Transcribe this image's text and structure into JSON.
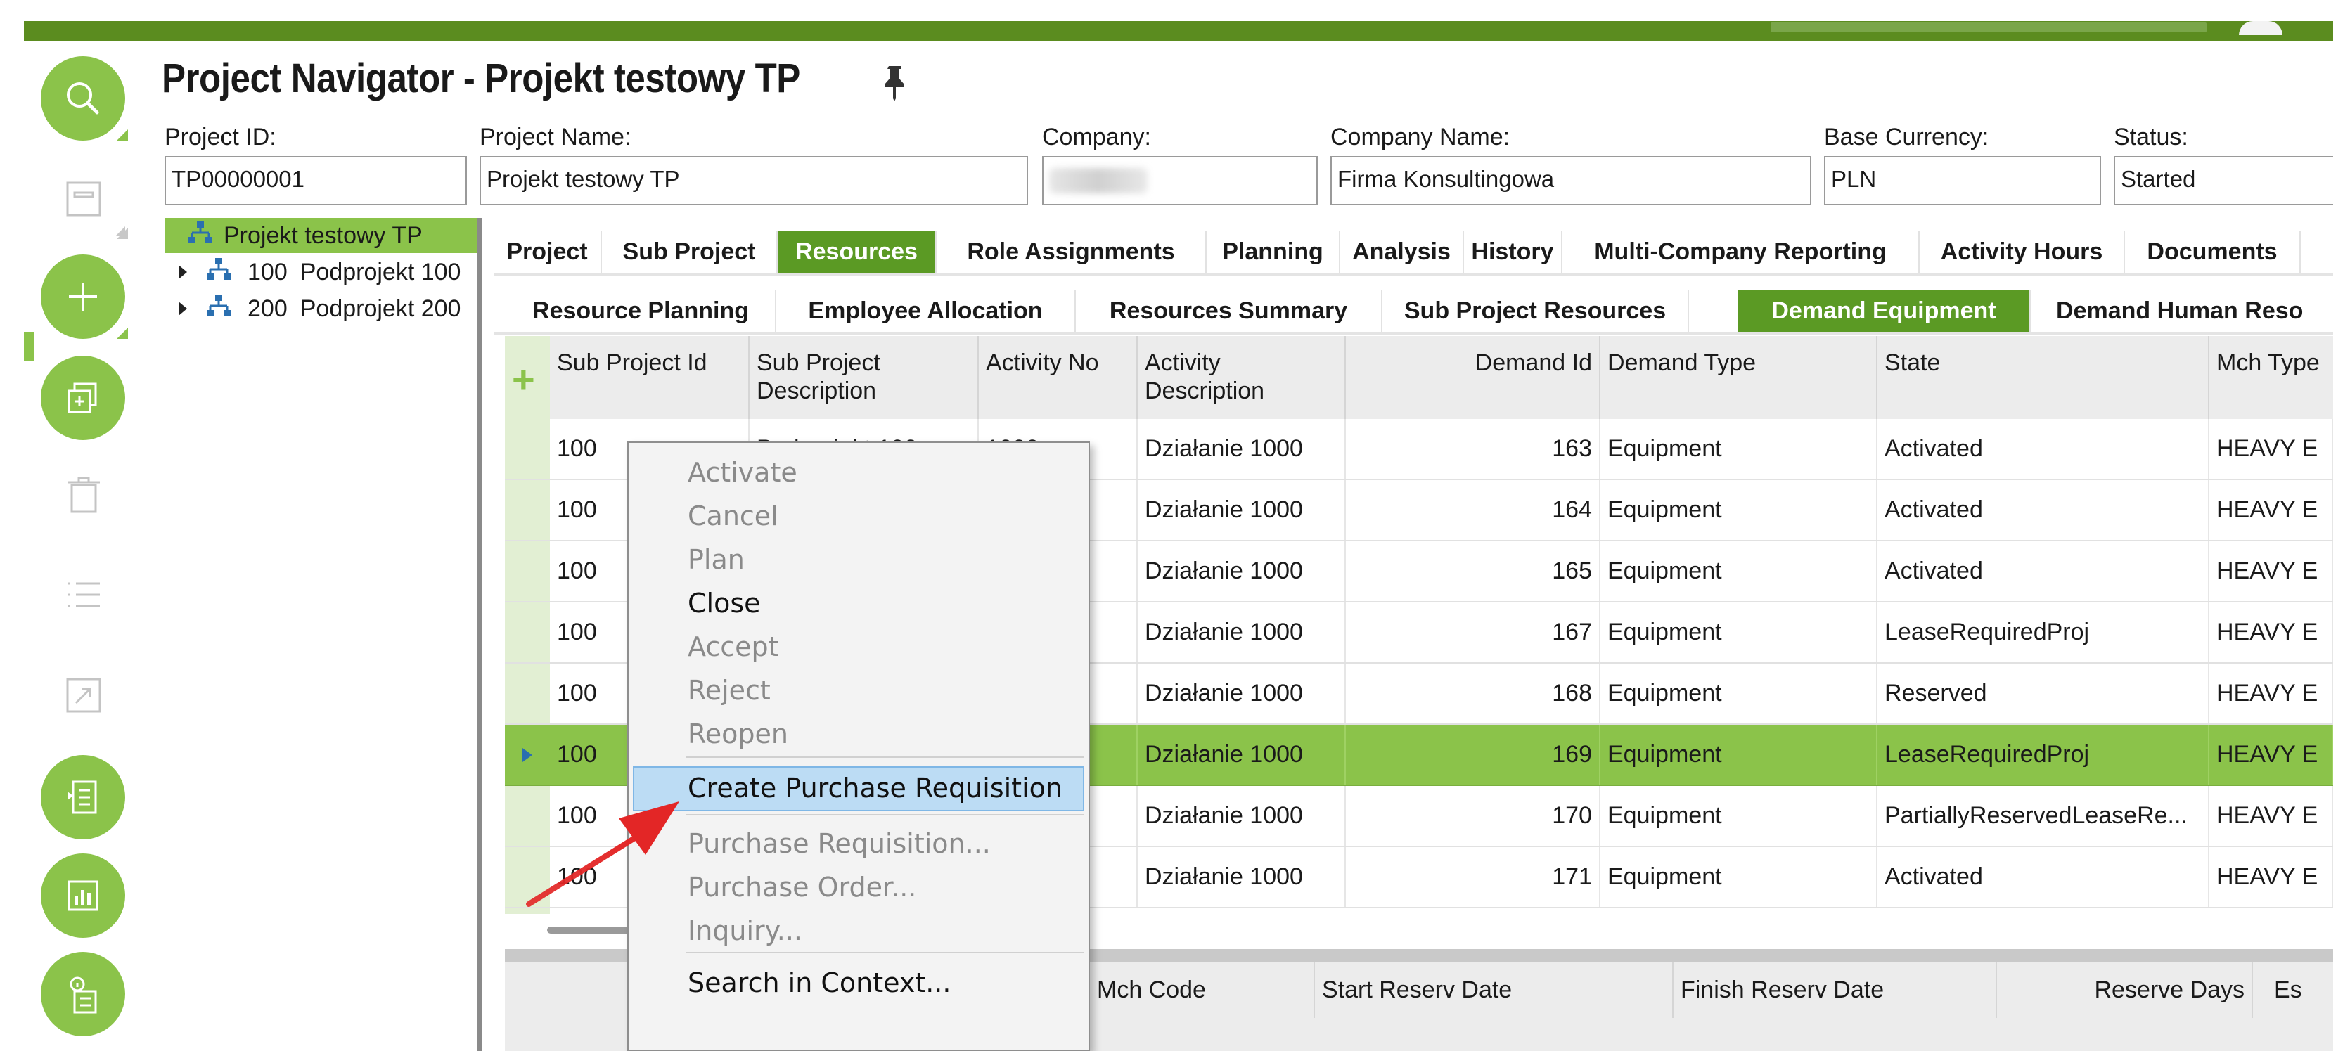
{
  "window": {
    "title": "Project Navigator - Projekt testowy TP"
  },
  "colors": {
    "accent": "#8bc34a",
    "accent_dark": "#5b9a24",
    "selection_blue": "#bcdcf4",
    "callout": "#e32626"
  },
  "rail": {
    "icons": [
      "search-icon",
      "save-icon",
      "add-icon",
      "duplicate-icon",
      "delete-icon",
      "list-icon",
      "expand-icon",
      "report-icon",
      "chart-icon",
      "info-icon"
    ]
  },
  "header": {
    "fields": [
      {
        "label": "Project ID:",
        "value": "TP00000001"
      },
      {
        "label": "Project Name:",
        "value": "Projekt testowy TP"
      },
      {
        "label": "Company:",
        "value": ""
      },
      {
        "label": "Company Name:",
        "value": "Firma Konsultingowa"
      },
      {
        "label": "Base Currency:",
        "value": "PLN"
      },
      {
        "label": "Status:",
        "value": "Started"
      }
    ]
  },
  "tree": {
    "root": "Projekt testowy TP",
    "children": [
      {
        "id": "100",
        "name": "Podprojekt 100"
      },
      {
        "id": "200",
        "name": "Podprojekt 200"
      }
    ]
  },
  "tabs": {
    "main": [
      "Project",
      "Sub Project",
      "Resources",
      "Role Assignments",
      "Planning",
      "Analysis",
      "History",
      "Multi-Company Reporting",
      "Activity Hours",
      "Documents"
    ],
    "main_active": "Resources",
    "sub": [
      "Resource Planning",
      "Employee Allocation",
      "Resources Summary",
      "Sub Project Resources",
      "Demand Equipment",
      "Demand Human Reso"
    ],
    "sub_active": "Demand Equipment"
  },
  "grid": {
    "columns": [
      "Sub Project Id",
      "Sub Project Description",
      "Activity No",
      "Activity Description",
      "Demand Id",
      "Demand Type",
      "State",
      "Mch Type"
    ],
    "rows": [
      {
        "sub_project_id": "100",
        "sub_project_desc": "Podprojekt 100",
        "activity_no": "1000",
        "activity_desc": "Działanie 1000",
        "demand_id": "163",
        "demand_type": "Equipment",
        "state": "Activated",
        "mch_type": "HEAVY E"
      },
      {
        "sub_project_id": "100",
        "sub_project_desc": "",
        "activity_no": "",
        "activity_desc": "Działanie 1000",
        "demand_id": "164",
        "demand_type": "Equipment",
        "state": "Activated",
        "mch_type": "HEAVY E"
      },
      {
        "sub_project_id": "100",
        "sub_project_desc": "",
        "activity_no": "",
        "activity_desc": "Działanie 1000",
        "demand_id": "165",
        "demand_type": "Equipment",
        "state": "Activated",
        "mch_type": "HEAVY E"
      },
      {
        "sub_project_id": "100",
        "sub_project_desc": "",
        "activity_no": "",
        "activity_desc": "Działanie 1000",
        "demand_id": "167",
        "demand_type": "Equipment",
        "state": "LeaseRequiredProj",
        "mch_type": "HEAVY E"
      },
      {
        "sub_project_id": "100",
        "sub_project_desc": "",
        "activity_no": "",
        "activity_desc": "Działanie 1000",
        "demand_id": "168",
        "demand_type": "Equipment",
        "state": "Reserved",
        "mch_type": "HEAVY E"
      },
      {
        "sub_project_id": "100",
        "sub_project_desc": "",
        "activity_no": "",
        "activity_desc": "Działanie 1000",
        "demand_id": "169",
        "demand_type": "Equipment",
        "state": "LeaseRequiredProj",
        "mch_type": "HEAVY E"
      },
      {
        "sub_project_id": "100",
        "sub_project_desc": "",
        "activity_no": "",
        "activity_desc": "Działanie 1000",
        "demand_id": "170",
        "demand_type": "Equipment",
        "state": "PartiallyReservedLeaseRe...",
        "mch_type": "HEAVY E"
      },
      {
        "sub_project_id": "100",
        "sub_project_desc": "",
        "activity_no": "",
        "activity_desc": "Działanie 1000",
        "demand_id": "171",
        "demand_type": "Equipment",
        "state": "Activated",
        "mch_type": "HEAVY E"
      }
    ],
    "selected_row_index": 5
  },
  "detail_grid": {
    "columns": [
      "Mch Code",
      "Start Reserv Date",
      "Finish Reserv Date",
      "Reserve Days",
      "Es"
    ]
  },
  "context_menu": {
    "items": [
      {
        "label": "Activate",
        "enabled": false
      },
      {
        "label": "Cancel",
        "enabled": false
      },
      {
        "label": "Plan",
        "enabled": false
      },
      {
        "label": "Close",
        "enabled": true
      },
      {
        "label": "Accept",
        "enabled": false
      },
      {
        "label": "Reject",
        "enabled": false
      },
      {
        "label": "Reopen",
        "enabled": false
      },
      {
        "label": "Create Purchase Requisition",
        "enabled": true,
        "highlighted": true
      },
      {
        "label": "Purchase Requisition...",
        "enabled": false
      },
      {
        "label": "Purchase Order...",
        "enabled": false
      },
      {
        "label": "Inquiry...",
        "enabled": false
      },
      {
        "label": "Search in Context...",
        "enabled": true
      }
    ]
  }
}
